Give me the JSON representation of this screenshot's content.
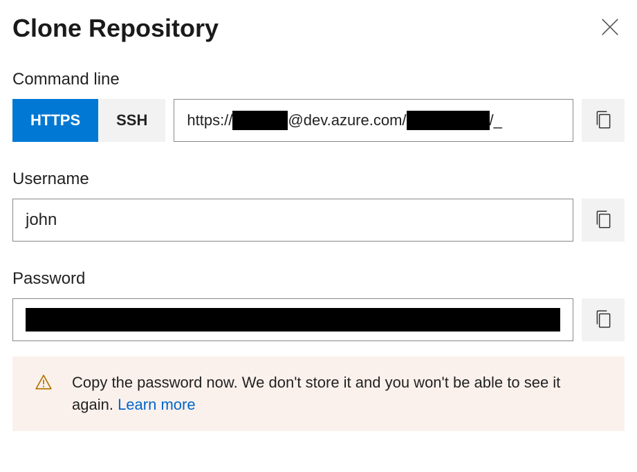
{
  "dialog": {
    "title": "Clone Repository"
  },
  "command_line": {
    "label": "Command line",
    "tabs": {
      "https": "HTTPS",
      "ssh": "SSH",
      "active": "https"
    },
    "url_prefix": "https://",
    "url_mid": "@dev.azure.com/",
    "url_suffix": "/_"
  },
  "username": {
    "label": "Username",
    "value": "john"
  },
  "password": {
    "label": "Password",
    "value_redacted": true
  },
  "alert": {
    "message": "Copy the password now. We don't store it and you won't be able to see it again. ",
    "link_text": "Learn more"
  }
}
